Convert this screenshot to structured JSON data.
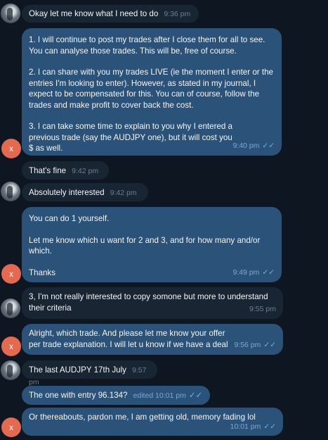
{
  "contacts": {
    "self_initial": "x"
  },
  "messages": [
    {
      "text": "Okay let me know what I need to do",
      "time": "9:36 pm"
    },
    {
      "paragraphs": [
        "1.  I will continue to post my trades after I close them for all to see. You can analyse those trades. This will be, free of course.",
        "2. I can share with you my trades LIVE (ie the moment I enter or the entries I'm looking to enter). However, as stated in my journal, I expect to be compensated for this.  You can of course, follow the trades and make profit to cover back the cost.",
        "3.  I can take some time to explain to you why I entered a previous trade (say the AUDJPY one), but it will cost you $ as well."
      ],
      "time": "9:40 pm",
      "ticks": "✓✓"
    },
    {
      "text": "That's fine",
      "time": "9:42 pm"
    },
    {
      "text": "Absolutely interested",
      "time": "9:42 pm"
    },
    {
      "paragraphs": [
        "You can do 1 yourself.",
        "Let me know which u want for 2 and 3, and for how many and/or which.",
        "Thanks"
      ],
      "time": "9:49 pm",
      "ticks": "✓✓"
    },
    {
      "text": "3,  I'm not really interested to copy somone but more to understand their criteria",
      "time": "9:55 pm"
    },
    {
      "text": "Alright, which trade. And please let me know your offer per trade explanation. I will let u know if we have a deal",
      "time": "9:56 pm",
      "ticks": "✓✓"
    },
    {
      "text": "The last AUDJPY 17th July",
      "time": "9:57 pm"
    },
    {
      "text": "The one with entry 96.134?",
      "time": "edited 10:01 pm",
      "ticks": "✓✓"
    },
    {
      "text": "Or thereabouts, pardon me, I am  getting old, memory fading lol",
      "time": "10:01 pm",
      "ticks": "✓✓"
    }
  ]
}
